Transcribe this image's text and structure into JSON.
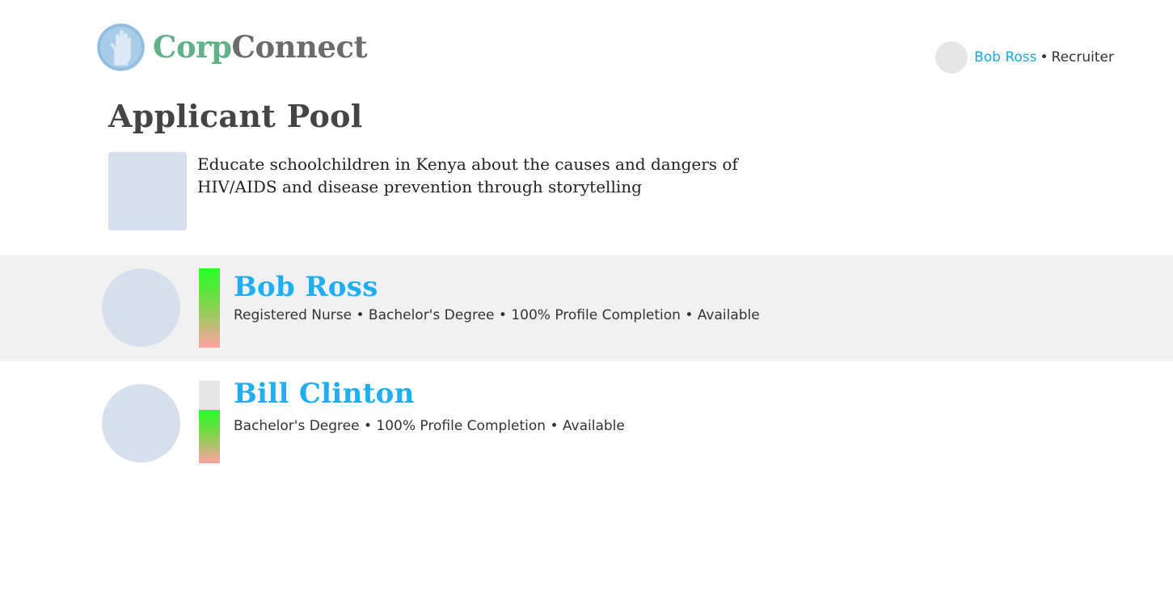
{
  "header": {
    "logo": {
      "part1": "Corp",
      "part2": "Connect"
    },
    "user": {
      "name": "Bob Ross",
      "separator": "•",
      "role": "Recruiter"
    }
  },
  "page_title": "Applicant Pool",
  "opportunity": {
    "description": "Educate schoolchildren in Kenya about the causes and dangers of HIV/AIDS and disease prevention through storytelling"
  },
  "applicants": [
    {
      "name": "Bob Ross",
      "details": "Registered Nurse • Bachelor's Degree • 100% Profile Completion • Available",
      "score_fraction": 1.0
    },
    {
      "name": "Bill Clinton",
      "details": "Bachelor's Degree • 100% Profile Completion • Available",
      "score_fraction": 0.65
    }
  ],
  "colors": {
    "brand_green": "#61b188",
    "brand_gray": "#6b6b6b",
    "link_blue": "#21aef0",
    "row_highlight": "#f1f1f1"
  },
  "icons": [
    "hand-logo-icon"
  ]
}
